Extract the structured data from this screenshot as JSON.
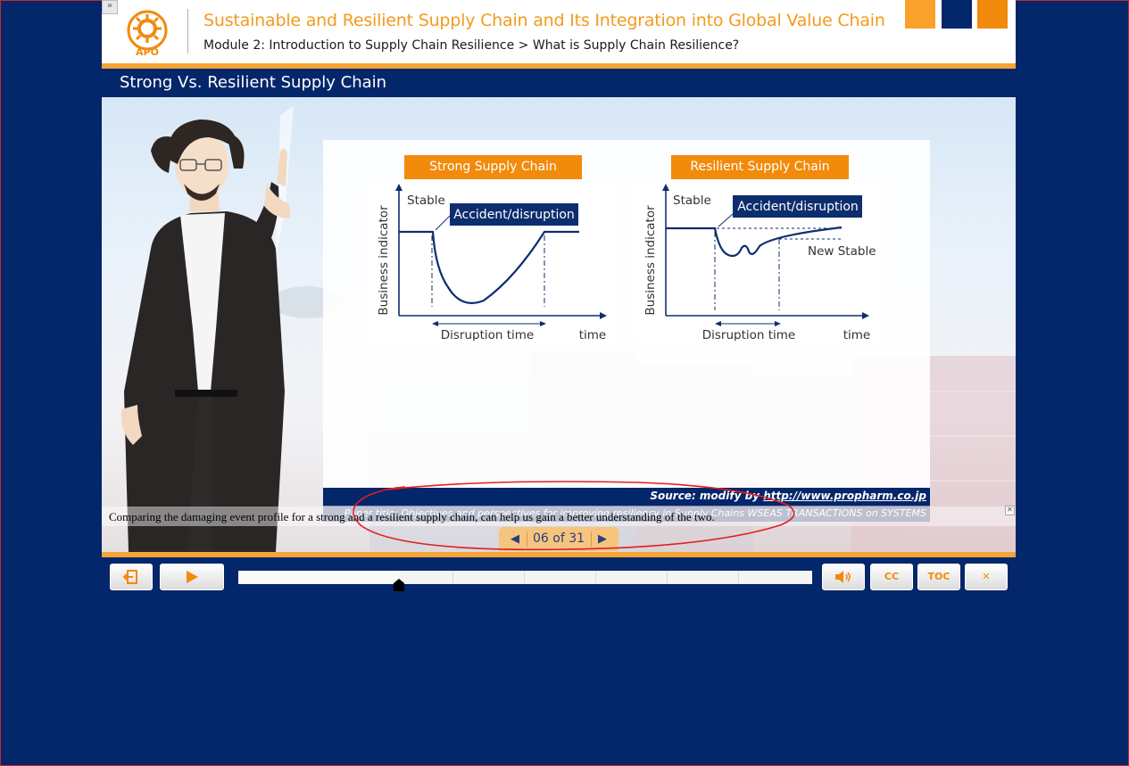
{
  "app": {
    "course_title": "Sustainable and Resilient Supply Chain and Its Integration into Global Value Chain",
    "breadcrumb": "Module 2: Introduction to Supply Chain Resilience > What is Supply Chain Resilience?",
    "logo_text": "APO",
    "collapse_glyph": "»"
  },
  "slide": {
    "title": "Strong Vs. Resilient Supply Chain",
    "charts": {
      "left": {
        "header": "Strong Supply Chain",
        "ylabel": "Business indicator",
        "stable_label": "Stable",
        "event_label": "Accident/disruption",
        "xspan_label": "Disruption time",
        "xlabel": "time"
      },
      "right": {
        "header": "Resilient Supply Chain",
        "ylabel": "Business indicator",
        "stable_label": "Stable",
        "event_label": "Accident/disruption",
        "new_stable_label": "New Stable",
        "xspan_label": "Disruption time",
        "xlabel": "time"
      }
    },
    "source_prefix": "Source: modify by ",
    "source_link": "http://www.propharm.co.jp",
    "paper_title": "Paper title: Objectives and perspectives for improving resiliency in Supply Chains WSEAS TRANSACTIONS on SYSTEMS",
    "caption": "Comparing the damaging event profile for a strong and a resilient supply chain, can help us gain a better understanding of the two.",
    "caption_close": "✕"
  },
  "pager": {
    "text": "06 of 31",
    "prev_glyph": "◀",
    "next_glyph": "▶"
  },
  "controls": {
    "exit_icon": "exit-icon",
    "play_icon": "play-icon",
    "volume_icon": "speaker-icon",
    "cc_label": "CC",
    "toc_label": "TOC",
    "close_glyph": "✕",
    "progress": 0.28
  },
  "colors": {
    "navy": "#04266a",
    "orange": "#f28a0c",
    "title_orange": "#f49a1c",
    "accent_line": "#f6a434",
    "annotation_red": "#e02020"
  }
}
